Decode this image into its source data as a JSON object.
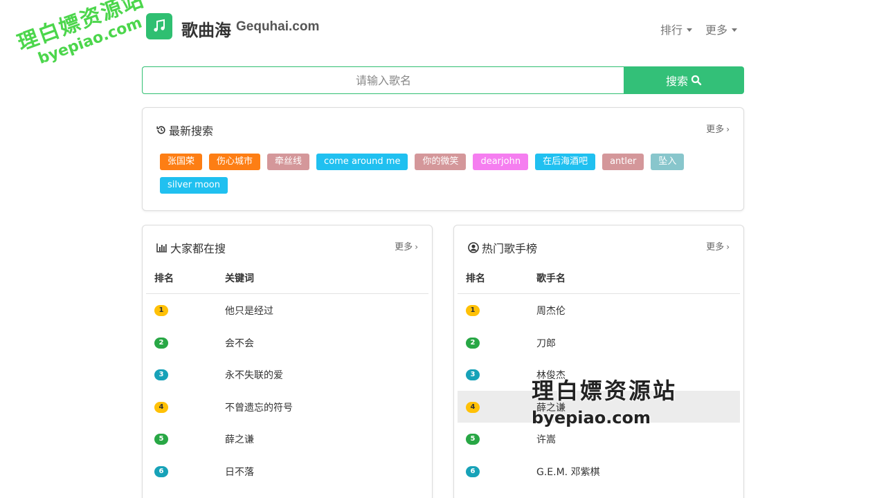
{
  "header": {
    "brand_cn": "歌曲海",
    "brand_en": "Gequhai.com",
    "nav": [
      {
        "label": "排行"
      },
      {
        "label": "更多"
      }
    ]
  },
  "search": {
    "placeholder": "请输入歌名",
    "button_label": "搜索"
  },
  "recent": {
    "title": "最新搜索",
    "more": "更多",
    "tags": [
      {
        "label": "张国荣",
        "color": "#fd7e14"
      },
      {
        "label": "伤心城市",
        "color": "#fd7e14"
      },
      {
        "label": "牵丝线",
        "color": "#d4979a"
      },
      {
        "label": "come around me",
        "color": "#20c0f0"
      },
      {
        "label": "你的微笑",
        "color": "#d4979a"
      },
      {
        "label": "dearjohn",
        "color": "#f57ef0"
      },
      {
        "label": "在后海酒吧",
        "color": "#20c0f0"
      },
      {
        "label": "antler",
        "color": "#d4979a"
      },
      {
        "label": "坠入",
        "color": "#88c6cc"
      },
      {
        "label": "silver moon",
        "color": "#20c0f0"
      }
    ]
  },
  "popular": {
    "title": "大家都在搜",
    "more": "更多",
    "col_rank": "排名",
    "col_name": "关键词",
    "rows": [
      {
        "rank": "1",
        "text": "他只是经过",
        "badge": "yellow"
      },
      {
        "rank": "2",
        "text": "会不会",
        "badge": "green"
      },
      {
        "rank": "3",
        "text": "永不失联的爱",
        "badge": "teal"
      },
      {
        "rank": "4",
        "text": "不曾遗忘的符号",
        "badge": "yellow"
      },
      {
        "rank": "5",
        "text": "薛之谦",
        "badge": "green"
      },
      {
        "rank": "6",
        "text": "日不落",
        "badge": "teal"
      }
    ]
  },
  "singers": {
    "title": "热门歌手榜",
    "more": "更多",
    "col_rank": "排名",
    "col_name": "歌手名",
    "rows": [
      {
        "rank": "1",
        "text": "周杰伦",
        "badge": "yellow"
      },
      {
        "rank": "2",
        "text": "刀郎",
        "badge": "green"
      },
      {
        "rank": "3",
        "text": "林俊杰",
        "badge": "teal"
      },
      {
        "rank": "4",
        "text": "薛之谦",
        "badge": "yellow"
      },
      {
        "rank": "5",
        "text": "许嵩",
        "badge": "green"
      },
      {
        "rank": "6",
        "text": "G.E.M. 邓紫棋",
        "badge": "teal"
      }
    ]
  },
  "watermark": {
    "line1": "理白嫖资源站",
    "line2": "byepiao.com"
  },
  "colors": {
    "accent": "#33c078",
    "badge_yellow": "#ffc107",
    "badge_green": "#28a745",
    "badge_teal": "#17a2b8"
  }
}
